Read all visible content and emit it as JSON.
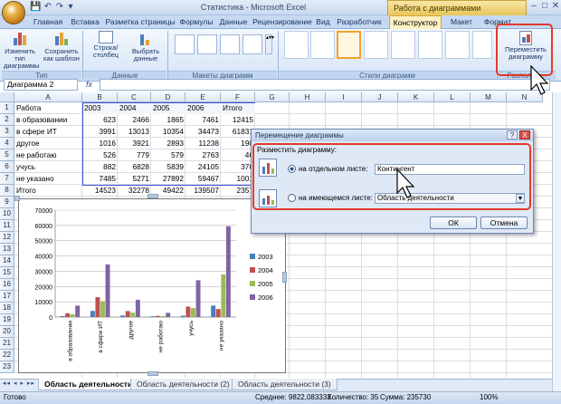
{
  "window": {
    "app_title": "Статистика - Microsoft Excel",
    "context_title": "Работа с диаграммами",
    "qat_icons": [
      "save-icon",
      "undo-icon",
      "redo-icon",
      "dropdown-icon"
    ]
  },
  "tabs": [
    "Главная",
    "Вставка",
    "Разметка страницы",
    "Формулы",
    "Данные",
    "Рецензирование",
    "Вид",
    "Разработчик",
    "Конструктор",
    "Макет",
    "Формат"
  ],
  "active_tab": "Конструктор",
  "ribbon": {
    "groups": {
      "type": "Тип",
      "data": "Данные",
      "layouts": "Макеты диаграмм",
      "styles": "Стили диаграмм",
      "location": "Располож..."
    },
    "buttons": {
      "change_type": "Изменить тип диаграммы",
      "save_template": "Сохранить как шаблон",
      "switch_row_col": "Строка/столбец",
      "select_data": "Выбрать данные",
      "move_chart": "Переместить диаграмму"
    }
  },
  "formula_bar": {
    "name_box": "Диаграмма 2",
    "fx_label": "fx",
    "formula": ""
  },
  "columns": [
    "A",
    "B",
    "C",
    "D",
    "E",
    "F",
    "G",
    "H",
    "I",
    "J",
    "K",
    "L",
    "M",
    "N"
  ],
  "rows": [
    "1",
    "2",
    "3",
    "4",
    "5",
    "6",
    "7",
    "8",
    "9",
    "10",
    "11",
    "12",
    "13",
    "14",
    "15",
    "16",
    "17",
    "18",
    "19",
    "20",
    "21",
    "22",
    "23",
    "24"
  ],
  "table": {
    "header": [
      "Работа",
      "2003",
      "2004",
      "2005",
      "2006",
      "Итого"
    ],
    "rows": [
      [
        "в образовании",
        "623",
        "2466",
        "1865",
        "7461",
        "12415"
      ],
      [
        "в сфере ИТ",
        "3991",
        "13013",
        "10354",
        "34473",
        "61831"
      ],
      [
        "другое",
        "1016",
        "3921",
        "2893",
        "11238",
        "190"
      ],
      [
        "не работаю",
        "526",
        "779",
        "579",
        "2763",
        "46"
      ],
      [
        "учусь",
        "882",
        "6828",
        "5839",
        "24105",
        "376"
      ],
      [
        "не указано",
        "7485",
        "5271",
        "27892",
        "59467",
        "1001"
      ]
    ],
    "total": [
      "Итого",
      "14523",
      "32278",
      "49422",
      "139507",
      "2357"
    ]
  },
  "chart_data": {
    "type": "bar",
    "categories": [
      "в образовании",
      "в сфере ИТ",
      "другое",
      "не работаю",
      "учусь",
      "не указано"
    ],
    "series": [
      {
        "name": "2003",
        "values": [
          623,
          3991,
          1016,
          526,
          882,
          7485
        ]
      },
      {
        "name": "2004",
        "values": [
          2466,
          13013,
          3921,
          779,
          6828,
          5271
        ]
      },
      {
        "name": "2005",
        "values": [
          1865,
          10354,
          2893,
          579,
          5839,
          27892
        ]
      },
      {
        "name": "2006",
        "values": [
          7461,
          34473,
          11238,
          2763,
          24105,
          59467
        ]
      }
    ],
    "colors": [
      "#4a7ebb",
      "#c0504d",
      "#9bbb59",
      "#8064a2"
    ],
    "ylim": [
      0,
      70000
    ],
    "yticks": [
      "0",
      "10000",
      "20000",
      "30000",
      "40000",
      "50000",
      "60000",
      "70000"
    ],
    "grid": true,
    "legend": "right"
  },
  "dialog": {
    "title": "Перемещение диаграммы",
    "prompt": "Разместить диаграмму:",
    "option_new_sheet": "на отдельном листе:",
    "new_sheet_value": "Контингент",
    "option_existing": "на имеющемся листе:",
    "existing_value": "Область деятельности",
    "ok": "ОК",
    "cancel": "Отмена",
    "help": "?",
    "close": "X"
  },
  "sheet_tabs": [
    "Область деятельности",
    "Область деятельности (2)",
    "Область деятельности (3)"
  ],
  "status": {
    "ready": "Готово",
    "average": "Среднее: 9822,083333",
    "count": "Количество: 35",
    "sum": "Сумма: 235730",
    "zoom": "100%"
  }
}
